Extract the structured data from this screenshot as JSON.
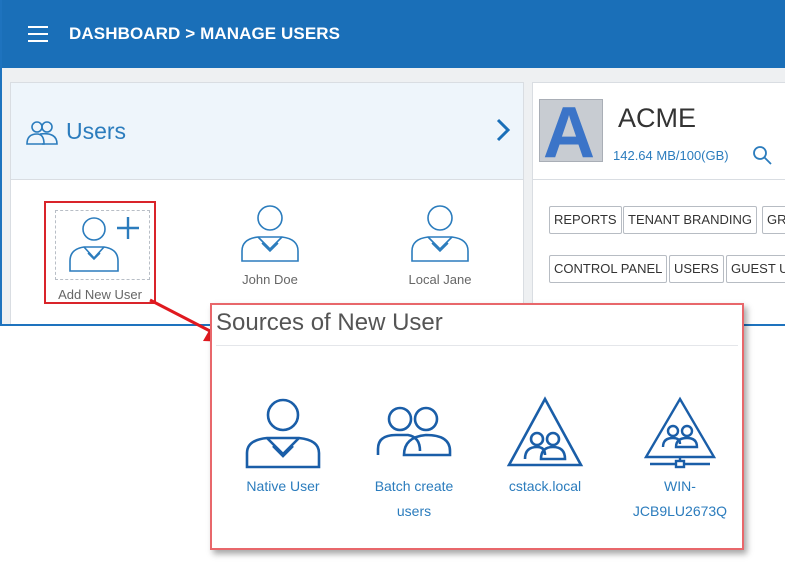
{
  "header": {
    "breadcrumb": "DASHBOARD > MANAGE USERS",
    "bg_color": "#1a6fb8"
  },
  "users_panel": {
    "title": "Users",
    "icon": "users-icon",
    "next_icon": "chevron-right-icon",
    "tiles": [
      {
        "label": "Add New User",
        "icon": "add-user-icon"
      },
      {
        "label": "John Doe",
        "icon": "user-icon"
      },
      {
        "label": "Local Jane",
        "icon": "user-icon"
      }
    ]
  },
  "tenant": {
    "logo_letter": "A",
    "name": "ACME",
    "usage": "142.64 MB/100(GB)",
    "search_icon": "search-icon",
    "chips_row1": [
      "REPORTS",
      "TENANT BRANDING",
      "GRO"
    ],
    "chips_row2": [
      "CONTROL PANEL",
      "USERS",
      "GUEST U"
    ]
  },
  "popup": {
    "title": "Sources of New User",
    "border_color": "#e8676b",
    "sources": [
      {
        "label_line1": "Native User",
        "label_line2": "",
        "icon": "user-icon"
      },
      {
        "label_line1": "Batch create",
        "label_line2": "users",
        "icon": "users-group-icon"
      },
      {
        "label_line1": "cstack.local",
        "label_line2": "",
        "icon": "ad-domain-icon"
      },
      {
        "label_line1": "WIN-",
        "label_line2": "JCB9LU2673Q",
        "icon": "ad-network-icon"
      }
    ]
  },
  "annotation": {
    "highlight_color": "#d9242a"
  }
}
